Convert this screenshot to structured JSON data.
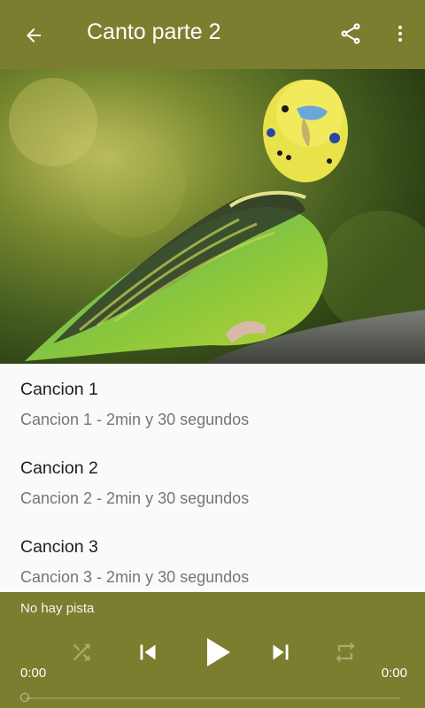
{
  "appbar": {
    "title": "Canto parte 2",
    "background": "#7c7e2f",
    "icons": {
      "back": "arrow-back-icon",
      "share": "share-icon",
      "more": "more-vert-icon"
    }
  },
  "hero": {
    "image": "budgerigar-photo"
  },
  "songs": [
    {
      "name": "Cancion 1",
      "description": "Cancion 1 - 2min y 30 segundos"
    },
    {
      "name": "Cancion 2",
      "description": "Cancion 2 - 2min y 30 segundos"
    },
    {
      "name": "Cancion 3",
      "description": "Cancion 3 - 2min y 30 segundos"
    }
  ],
  "player": {
    "now_playing": "No hay pista",
    "elapsed": "0:00",
    "duration": "0:00",
    "progress": 0,
    "icons": {
      "shuffle": "shuffle-icon",
      "previous": "skip-previous-icon",
      "play": "play-icon",
      "next": "skip-next-icon",
      "repeat": "repeat-icon"
    }
  },
  "colors": {
    "accent": "#7c7e2f",
    "list_background": "#fafafa",
    "primary_text": "#202020",
    "secondary_text": "#757575"
  }
}
